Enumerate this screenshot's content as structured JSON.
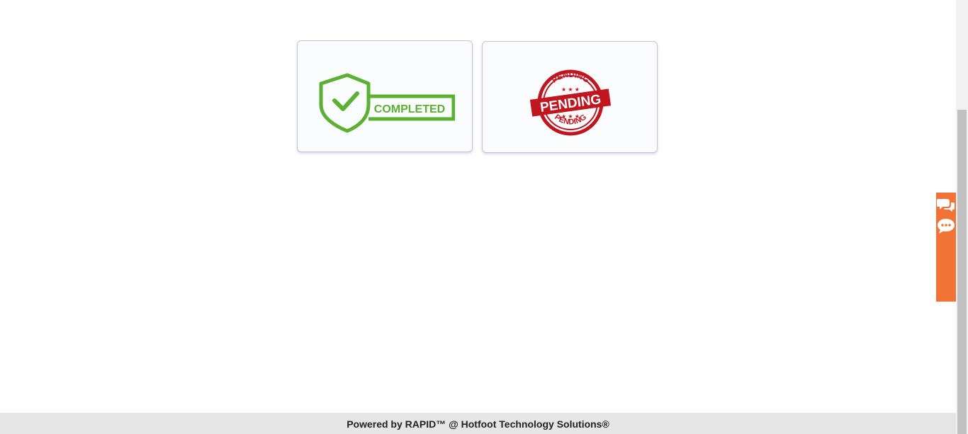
{
  "status_cards": [
    {
      "label": "COMPLETED",
      "icon": "completed-shield-icon",
      "color": "#5bb132"
    },
    {
      "label": "PENDING",
      "icon": "pending-stamp-icon",
      "color": "#c1151f"
    }
  ],
  "side_tab": {
    "color": "#f27335",
    "icons": [
      "chat-bubbles-icon",
      "comment-icon"
    ]
  },
  "footer": {
    "text": "Powered by RAPID™ @ Hotfoot Technology Solutions®"
  }
}
